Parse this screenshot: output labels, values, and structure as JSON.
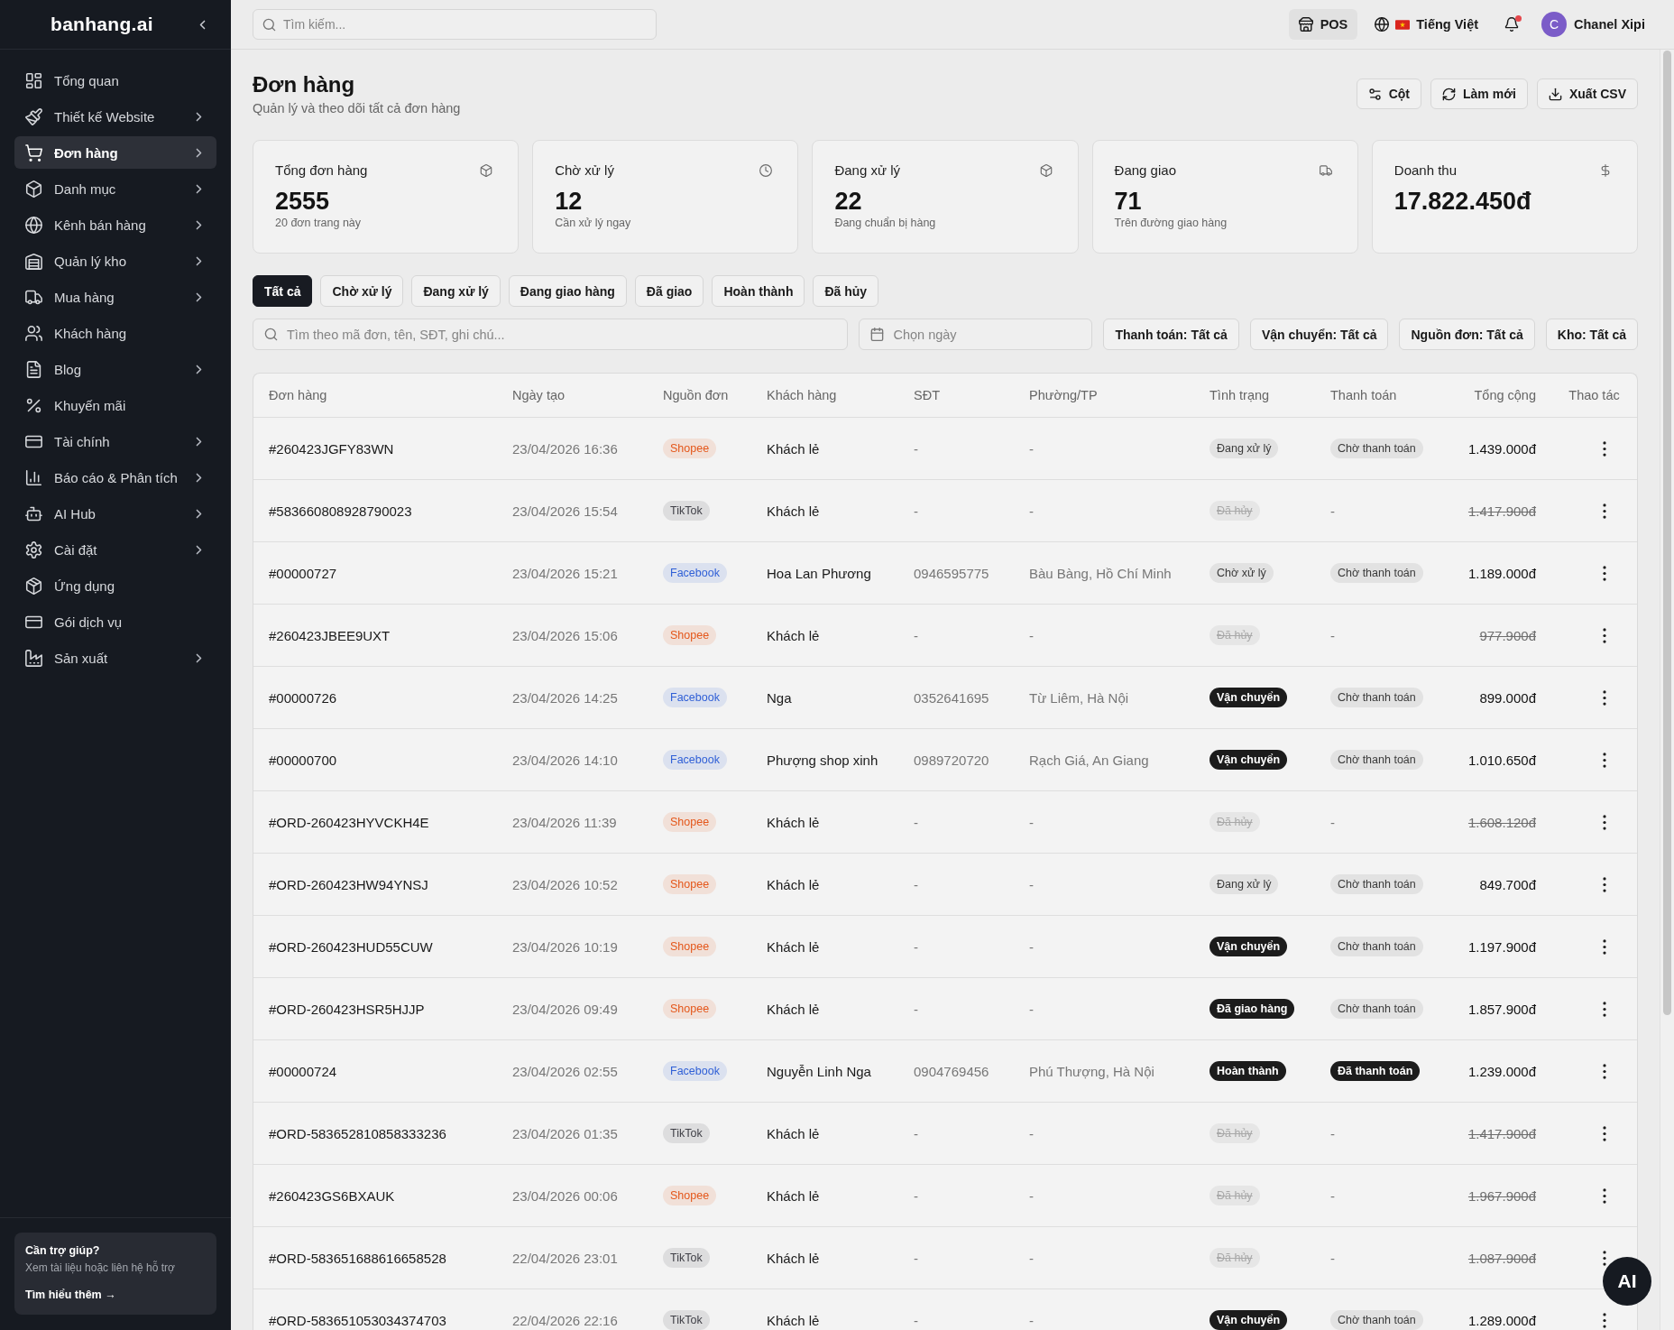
{
  "sidebar": {
    "logo": "banhang.ai",
    "items": [
      {
        "label": "Tổng quan",
        "has_submenu": false,
        "selected": false
      },
      {
        "label": "Thiết kế Website",
        "has_submenu": true,
        "selected": false
      },
      {
        "label": "Đơn hàng",
        "has_submenu": true,
        "selected": true
      },
      {
        "label": "Danh mục",
        "has_submenu": true,
        "selected": false
      },
      {
        "label": "Kênh bán hàng",
        "has_submenu": true,
        "selected": false
      },
      {
        "label": "Quản lý kho",
        "has_submenu": true,
        "selected": false
      },
      {
        "label": "Mua hàng",
        "has_submenu": true,
        "selected": false
      },
      {
        "label": "Khách hàng",
        "has_submenu": false,
        "selected": false
      },
      {
        "label": "Blog",
        "has_submenu": true,
        "selected": false
      },
      {
        "label": "Khuyến mãi",
        "has_submenu": false,
        "selected": false
      },
      {
        "label": "Tài chính",
        "has_submenu": true,
        "selected": false
      },
      {
        "label": "Báo cáo & Phân tích",
        "has_submenu": true,
        "selected": false
      },
      {
        "label": "AI Hub",
        "has_submenu": true,
        "selected": false
      },
      {
        "label": "Cài đặt",
        "has_submenu": true,
        "selected": false
      },
      {
        "label": "Ứng dụng",
        "has_submenu": false,
        "selected": false
      },
      {
        "label": "Gói dịch vụ",
        "has_submenu": false,
        "selected": false
      },
      {
        "label": "Sản xuất",
        "has_submenu": true,
        "selected": false
      }
    ],
    "help": {
      "title": "Cần trợ giúp?",
      "text": "Xem tài liệu hoặc liên hệ hỗ trợ",
      "link": "Tìm hiểu thêm →"
    }
  },
  "topbar": {
    "search": {
      "placeholder": "Tìm kiếm..."
    },
    "pos_button": "POS",
    "language": "Tiếng Việt",
    "notifications": {
      "unread": true
    },
    "user": {
      "initial": "C",
      "name": "Chanel Xipi"
    }
  },
  "page": {
    "title": "Đơn hàng",
    "subtitle": "Quản lý và theo dõi tất cả đơn hàng",
    "actions": [
      "Cột",
      "Làm mới",
      "Xuất CSV"
    ]
  },
  "stats": [
    {
      "label": "Tổng đơn hàng",
      "value": "2555",
      "note": "20 đơn trang này"
    },
    {
      "label": "Chờ xử lý",
      "value": "12",
      "note": "Cần xử lý ngay"
    },
    {
      "label": "Đang xử lý",
      "value": "22",
      "note": "Đang chuẩn bị hàng"
    },
    {
      "label": "Đang giao",
      "value": "71",
      "note": "Trên đường giao hàng"
    },
    {
      "label": "Doanh thu",
      "value": "17.822.450đ"
    }
  ],
  "tabs": [
    {
      "label": "Tất cả",
      "selected": true
    },
    {
      "label": "Chờ xử lý",
      "selected": false
    },
    {
      "label": "Đang xử lý",
      "selected": false
    },
    {
      "label": "Đang giao hàng",
      "selected": false
    },
    {
      "label": "Đã giao",
      "selected": false
    },
    {
      "label": "Hoàn thành",
      "selected": false
    },
    {
      "label": "Đã hủy",
      "selected": false
    }
  ],
  "filters": {
    "search": {
      "placeholder": "Tìm theo mã đơn, tên, SĐT, ghi chú..."
    },
    "date": {
      "placeholder": "Chọn ngày"
    },
    "dropdowns": [
      "Thanh toán: Tất cả",
      "Vận chuyển: Tất cả",
      "Nguồn đơn: Tất cả",
      "Kho: Tất cả"
    ]
  },
  "table": {
    "columns": [
      "Đơn hàng",
      "Ngày tạo",
      "Nguồn đơn",
      "Khách hàng",
      "SĐT",
      "Phường/TP",
      "Tình trạng",
      "Thanh toán",
      "Tổng cộng",
      "Thao tác"
    ],
    "rows": [
      {
        "order": "#260423JGFY83WN",
        "created": "23/04/2026 16:36",
        "source": {
          "label": "Shopee",
          "color": "#e4571b"
        },
        "customer": "Khách lẻ",
        "phone": "-",
        "location": "-",
        "status": {
          "label": "Đang xử lý",
          "kind": "soft"
        },
        "payment": {
          "label": "Chờ thanh toán",
          "kind": "soft"
        },
        "total": "1.439.000đ",
        "cancelled": false
      },
      {
        "order": "#583660808928790023",
        "created": "23/04/2026 15:54",
        "source": {
          "label": "TikTok",
          "color": "#3f3f46"
        },
        "customer": "Khách lẻ",
        "phone": "-",
        "location": "-",
        "status": {
          "label": "Đã hủy",
          "kind": "soft"
        },
        "payment": {
          "label": "-",
          "kind": "plain"
        },
        "total": "1.417.900đ",
        "cancelled": true
      },
      {
        "order": "#00000727",
        "created": "23/04/2026 15:21",
        "source": {
          "label": "Facebook",
          "color": "#2f5fd6"
        },
        "customer": "Hoa Lan Phương",
        "phone": "0946595775",
        "location": "Bàu Bàng, Hồ Chí Minh",
        "status": {
          "label": "Chờ xử lý",
          "kind": "soft"
        },
        "payment": {
          "label": "Chờ thanh toán",
          "kind": "soft"
        },
        "total": "1.189.000đ",
        "cancelled": false
      },
      {
        "order": "#260423JBEE9UXT",
        "created": "23/04/2026 15:06",
        "source": {
          "label": "Shopee",
          "color": "#e4571b"
        },
        "customer": "Khách lẻ",
        "phone": "-",
        "location": "-",
        "status": {
          "label": "Đã hủy",
          "kind": "soft"
        },
        "payment": {
          "label": "-",
          "kind": "plain"
        },
        "total": "977.900đ",
        "cancelled": true
      },
      {
        "order": "#00000726",
        "created": "23/04/2026 14:25",
        "source": {
          "label": "Facebook",
          "color": "#2f5fd6"
        },
        "customer": "Nga",
        "phone": "0352641695",
        "location": "Từ Liêm, Hà Nội",
        "status": {
          "label": "Vận chuyển",
          "kind": "solid"
        },
        "payment": {
          "label": "Chờ thanh toán",
          "kind": "soft"
        },
        "total": "899.000đ",
        "cancelled": false
      },
      {
        "order": "#00000700",
        "created": "23/04/2026 14:10",
        "source": {
          "label": "Facebook",
          "color": "#2f5fd6"
        },
        "customer": "Phượng shop xinh",
        "phone": "0989720720",
        "location": "Rạch Giá, An Giang",
        "status": {
          "label": "Vận chuyển",
          "kind": "solid"
        },
        "payment": {
          "label": "Chờ thanh toán",
          "kind": "soft"
        },
        "total": "1.010.650đ",
        "cancelled": false
      },
      {
        "order": "#ORD-260423HYVCKH4E",
        "created": "23/04/2026 11:39",
        "source": {
          "label": "Shopee",
          "color": "#e4571b"
        },
        "customer": "Khách lẻ",
        "phone": "-",
        "location": "-",
        "status": {
          "label": "Đã hủy",
          "kind": "soft"
        },
        "payment": {
          "label": "-",
          "kind": "plain"
        },
        "total": "1.608.120đ",
        "cancelled": true
      },
      {
        "order": "#ORD-260423HW94YNSJ",
        "created": "23/04/2026 10:52",
        "source": {
          "label": "Shopee",
          "color": "#e4571b"
        },
        "customer": "Khách lẻ",
        "phone": "-",
        "location": "-",
        "status": {
          "label": "Đang xử lý",
          "kind": "soft"
        },
        "payment": {
          "label": "Chờ thanh toán",
          "kind": "soft"
        },
        "total": "849.700đ",
        "cancelled": false
      },
      {
        "order": "#ORD-260423HUD55CUW",
        "created": "23/04/2026 10:19",
        "source": {
          "label": "Shopee",
          "color": "#e4571b"
        },
        "customer": "Khách lẻ",
        "phone": "-",
        "location": "-",
        "status": {
          "label": "Vận chuyển",
          "kind": "solid"
        },
        "payment": {
          "label": "Chờ thanh toán",
          "kind": "soft"
        },
        "total": "1.197.900đ",
        "cancelled": false
      },
      {
        "order": "#ORD-260423HSR5HJJP",
        "created": "23/04/2026 09:49",
        "source": {
          "label": "Shopee",
          "color": "#e4571b"
        },
        "customer": "Khách lẻ",
        "phone": "-",
        "location": "-",
        "status": {
          "label": "Đã giao hàng",
          "kind": "solid"
        },
        "payment": {
          "label": "Chờ thanh toán",
          "kind": "soft"
        },
        "total": "1.857.900đ",
        "cancelled": false
      },
      {
        "order": "#00000724",
        "created": "23/04/2026 02:55",
        "source": {
          "label": "Facebook",
          "color": "#2f5fd6"
        },
        "customer": "Nguyễn Linh Nga",
        "phone": "0904769456",
        "location": "Phú Thượng, Hà Nội",
        "status": {
          "label": "Hoàn thành",
          "kind": "solid"
        },
        "payment": {
          "label": "Đã thanh toán",
          "kind": "solid"
        },
        "total": "1.239.000đ",
        "cancelled": false
      },
      {
        "order": "#ORD-583652810858333236",
        "created": "23/04/2026 01:35",
        "source": {
          "label": "TikTok",
          "color": "#3f3f46"
        },
        "customer": "Khách lẻ",
        "phone": "-",
        "location": "-",
        "status": {
          "label": "Đã hủy",
          "kind": "soft"
        },
        "payment": {
          "label": "-",
          "kind": "plain"
        },
        "total": "1.417.900đ",
        "cancelled": true
      },
      {
        "order": "#260423GS6BXAUK",
        "created": "23/04/2026 00:06",
        "source": {
          "label": "Shopee",
          "color": "#e4571b"
        },
        "customer": "Khách lẻ",
        "phone": "-",
        "location": "-",
        "status": {
          "label": "Đã hủy",
          "kind": "soft"
        },
        "payment": {
          "label": "-",
          "kind": "plain"
        },
        "total": "1.967.900đ",
        "cancelled": true
      },
      {
        "order": "#ORD-583651688616658528",
        "created": "22/04/2026 23:01",
        "source": {
          "label": "TikTok",
          "color": "#3f3f46"
        },
        "customer": "Khách lẻ",
        "phone": "-",
        "location": "-",
        "status": {
          "label": "Đã hủy",
          "kind": "soft"
        },
        "payment": {
          "label": "-",
          "kind": "plain"
        },
        "total": "1.087.900đ",
        "cancelled": true
      },
      {
        "order": "#ORD-583651053034374703",
        "created": "22/04/2026 22:16",
        "source": {
          "label": "TikTok",
          "color": "#3f3f46"
        },
        "customer": "Khách lẻ",
        "phone": "-",
        "location": "-",
        "status": {
          "label": "Vận chuyển",
          "kind": "solid"
        },
        "payment": {
          "label": "Chờ thanh toán",
          "kind": "soft"
        },
        "total": "1.289.000đ",
        "cancelled": false
      }
    ]
  },
  "assistant_button": "AI"
}
